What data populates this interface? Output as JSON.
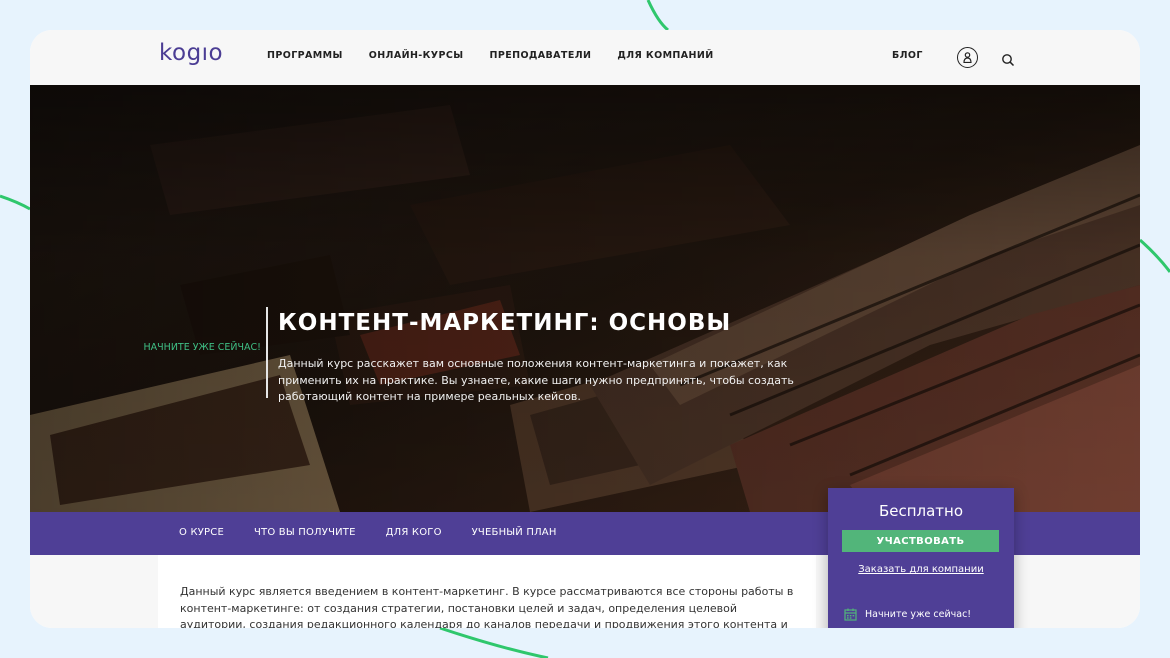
{
  "header": {
    "logo": "kogıo",
    "nav": [
      "ПРОГРАММЫ",
      "ОНЛАЙН-КУРСЫ",
      "ПРЕПОДАВАТЕЛИ",
      "ДЛЯ КОМПАНИЙ"
    ],
    "blog": "БЛОГ",
    "user_icon": "user-icon",
    "search_icon": "search-icon"
  },
  "hero": {
    "start_now": "Начните уже сейчас!",
    "title": "КОНТЕНТ-МАРКЕТИНГ: ОСНОВЫ",
    "description": "Данный курс расскажет вам основные положения контент-маркетинга и покажет, как применить их на практике. Вы узнаете, какие шаги нужно предпринять, чтобы создать работающий контент на примере реальных кейсов."
  },
  "subnav": [
    "О КУРСЕ",
    "ЧТО ВЫ ПОЛУЧИТЕ",
    "ДЛЯ КОГО",
    "УЧЕБНЫЙ ПЛАН"
  ],
  "content": {
    "text": "Данный курс является введением в контент-маркетинг. В курсе рассматриваются все стороны работы в контент-маркетинге: от создания стратегии, постановки целей и задач, определения целевой аудитории, создания редакционного календаря до каналов передачи и продвижения этого контента и анализа"
  },
  "price_card": {
    "price": "Бесплатно",
    "join": "УЧАСТВОВАТЬ",
    "order": "Заказать для компании",
    "start_now": "Начните уже сейчас!",
    "calendar_icon": "calendar-icon"
  },
  "colors": {
    "brand": "#4f3f96",
    "accent_green": "#52b57a",
    "page_bg": "#e7f3fd",
    "deco_line": "#2fc76c"
  }
}
